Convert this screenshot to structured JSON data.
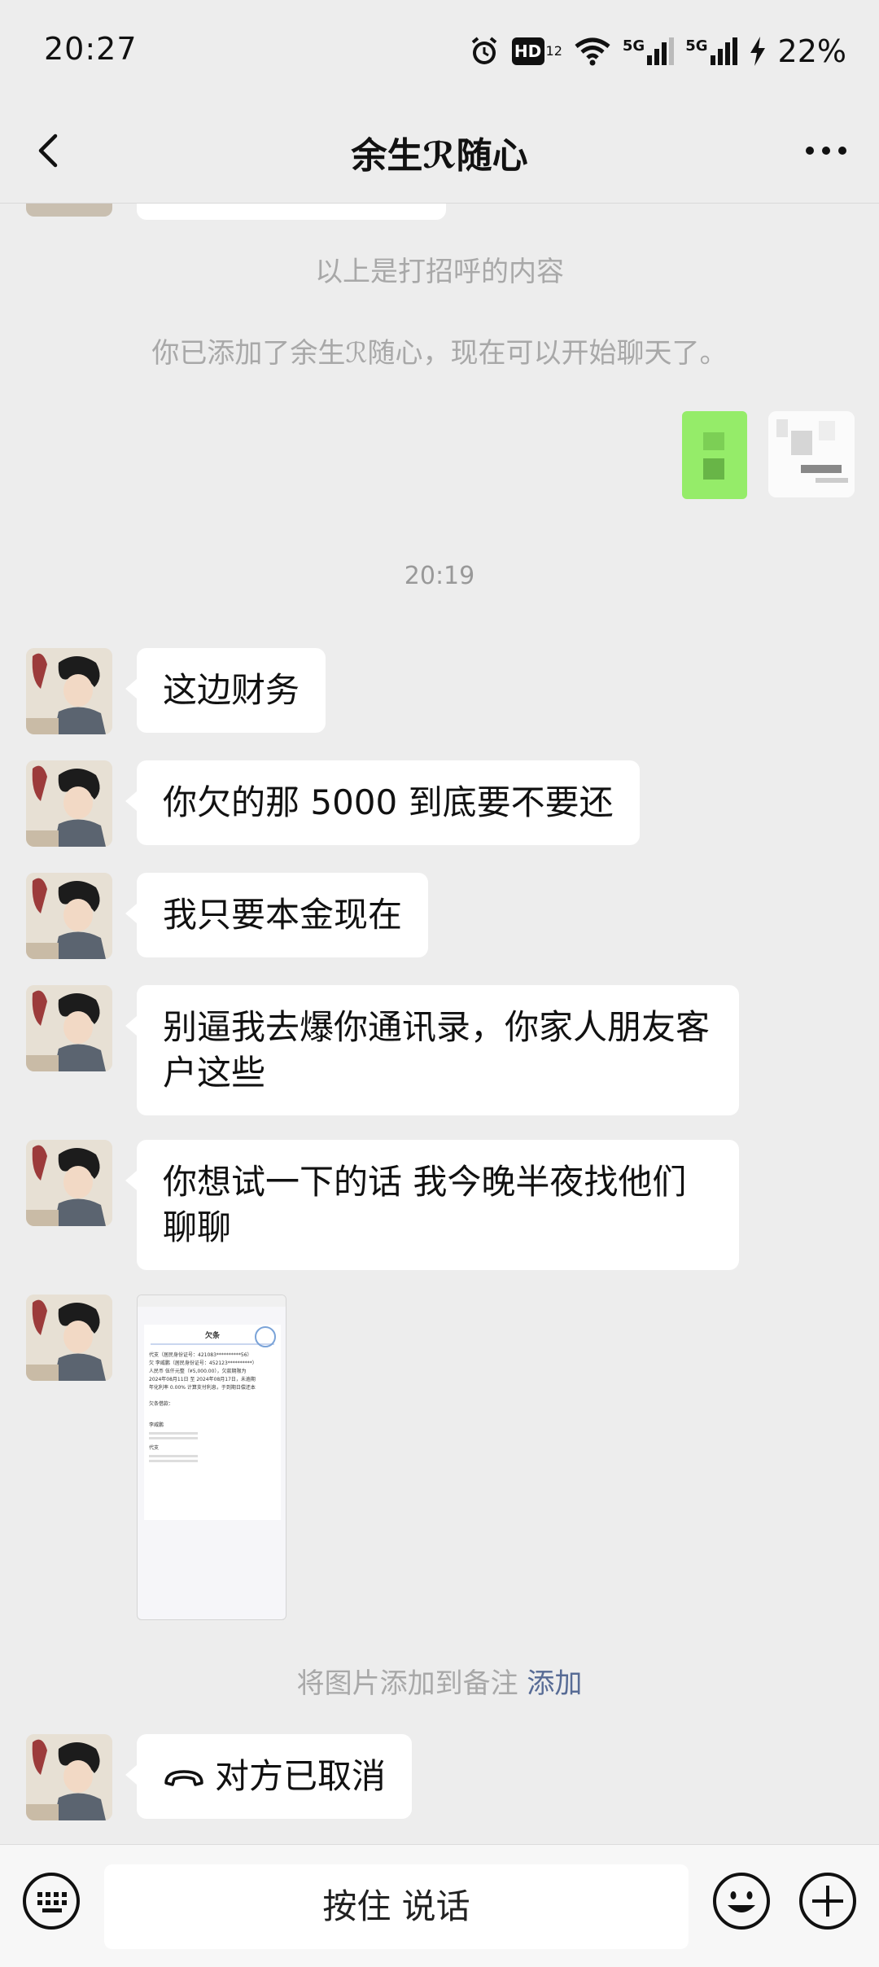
{
  "status_bar": {
    "time": "20:27",
    "hd_label": "HD",
    "hd_sub": "12",
    "net1": "5G",
    "net2": "5G",
    "battery": "22%"
  },
  "nav": {
    "title": "余生ℛ随心"
  },
  "chat": {
    "system_greeting": "以上是打招呼的内容",
    "system_added": "你已添加了余生ℛ随心，现在可以开始聊天了。",
    "timestamp": "20:19",
    "messages": [
      "这边财务",
      "你欠的那 5000 到底要不要还",
      "我只要本金现在",
      "别逼我去爆你通讯录，你家人朋友客户这些",
      "你想试一下的话 我今晚半夜找他们聊聊"
    ],
    "image_preview": {
      "header": "欠条",
      "line1": "代支（居民身份证号：421083**********56）",
      "line2": "欠 李威鹏（居民身份证号：452123**********）",
      "line3": "人民币 伍仟元整（¥5,000.00），欠款期限为",
      "line4": "2024年08月11日 至 2024年08月17日，未逾期",
      "line5": "年化利率 0.00% 计算支付利息，于到期日偿还本",
      "footer_label": "欠条借款：",
      "name1": "李威鹏",
      "name2": "代支"
    },
    "add_note_text": "将图片添加到备注",
    "add_note_link": "添加",
    "call_text": "对方已取消"
  },
  "input_bar": {
    "hold_to_talk": "按住 说话"
  },
  "colors": {
    "background": "#ededed",
    "bubble_in": "#ffffff",
    "bubble_out": "#95ec69",
    "link": "#576b95",
    "system_text": "#a8a8a8"
  }
}
